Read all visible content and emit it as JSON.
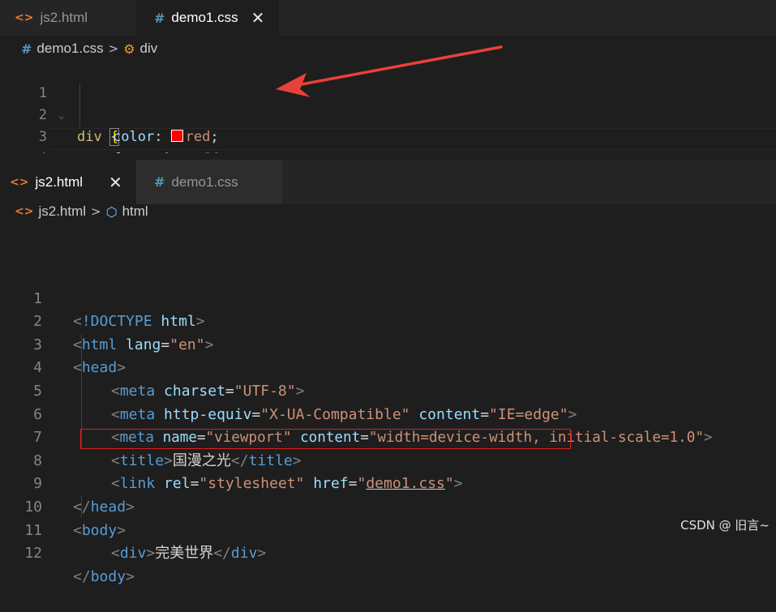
{
  "top_editor": {
    "tabs": [
      {
        "label": "js2.html",
        "icon": "html-icon",
        "active": false
      },
      {
        "label": "demo1.css",
        "icon": "css-icon",
        "active": true,
        "close": "✕"
      }
    ],
    "breadcrumb": {
      "file": "demo1.css",
      "symbol": "div"
    },
    "lines": [
      {
        "n": "1"
      },
      {
        "n": "2"
      },
      {
        "n": "3"
      },
      {
        "n": "4"
      }
    ],
    "code": {
      "selector": "div",
      "open_brace": "{",
      "prop1": "color",
      "value1": "red",
      "prop2": "font-size",
      "value2": "30px",
      "close_brace": "}"
    },
    "swatch_color": "#ff0000"
  },
  "bottom_editor": {
    "tabs": [
      {
        "label": "js2.html",
        "icon": "html-icon",
        "active": true,
        "close": "✕"
      },
      {
        "label": "demo1.css",
        "icon": "css-icon",
        "active": false
      }
    ],
    "breadcrumb": {
      "file": "js2.html",
      "symbol": "html"
    },
    "lines": [
      "1",
      "2",
      "3",
      "4",
      "5",
      "6",
      "7",
      "8",
      "9",
      "10",
      "11",
      "12"
    ],
    "code": {
      "doctype": "!DOCTYPE",
      "html": "html",
      "lang_attr": "lang",
      "lang_val": "\"en\"",
      "head": "head",
      "meta": "meta",
      "charset_attr": "charset",
      "charset_val": "\"UTF-8\"",
      "http_equiv_attr": "http-equiv",
      "http_equiv_val": "\"X-UA-Compatible\"",
      "content_attr": "content",
      "ie_val": "\"IE=edge\"",
      "name_attr": "name",
      "viewport_val": "\"viewport\"",
      "viewport_content": "\"width=device-width, initial-scale=1.0\"",
      "title": "title",
      "title_text": "国漫之光",
      "link": "link",
      "rel_attr": "rel",
      "rel_val": "\"stylesheet\"",
      "href_attr": "href",
      "href_q1": "\"",
      "href_val": "demo1.css",
      "href_q2": "\"",
      "body": "body",
      "div": "div",
      "div_text": "完美世界"
    }
  },
  "annotation": {
    "arrow_color": "#e8413a",
    "box_color": "#e02020"
  },
  "watermark": "CSDN @ 旧言~"
}
